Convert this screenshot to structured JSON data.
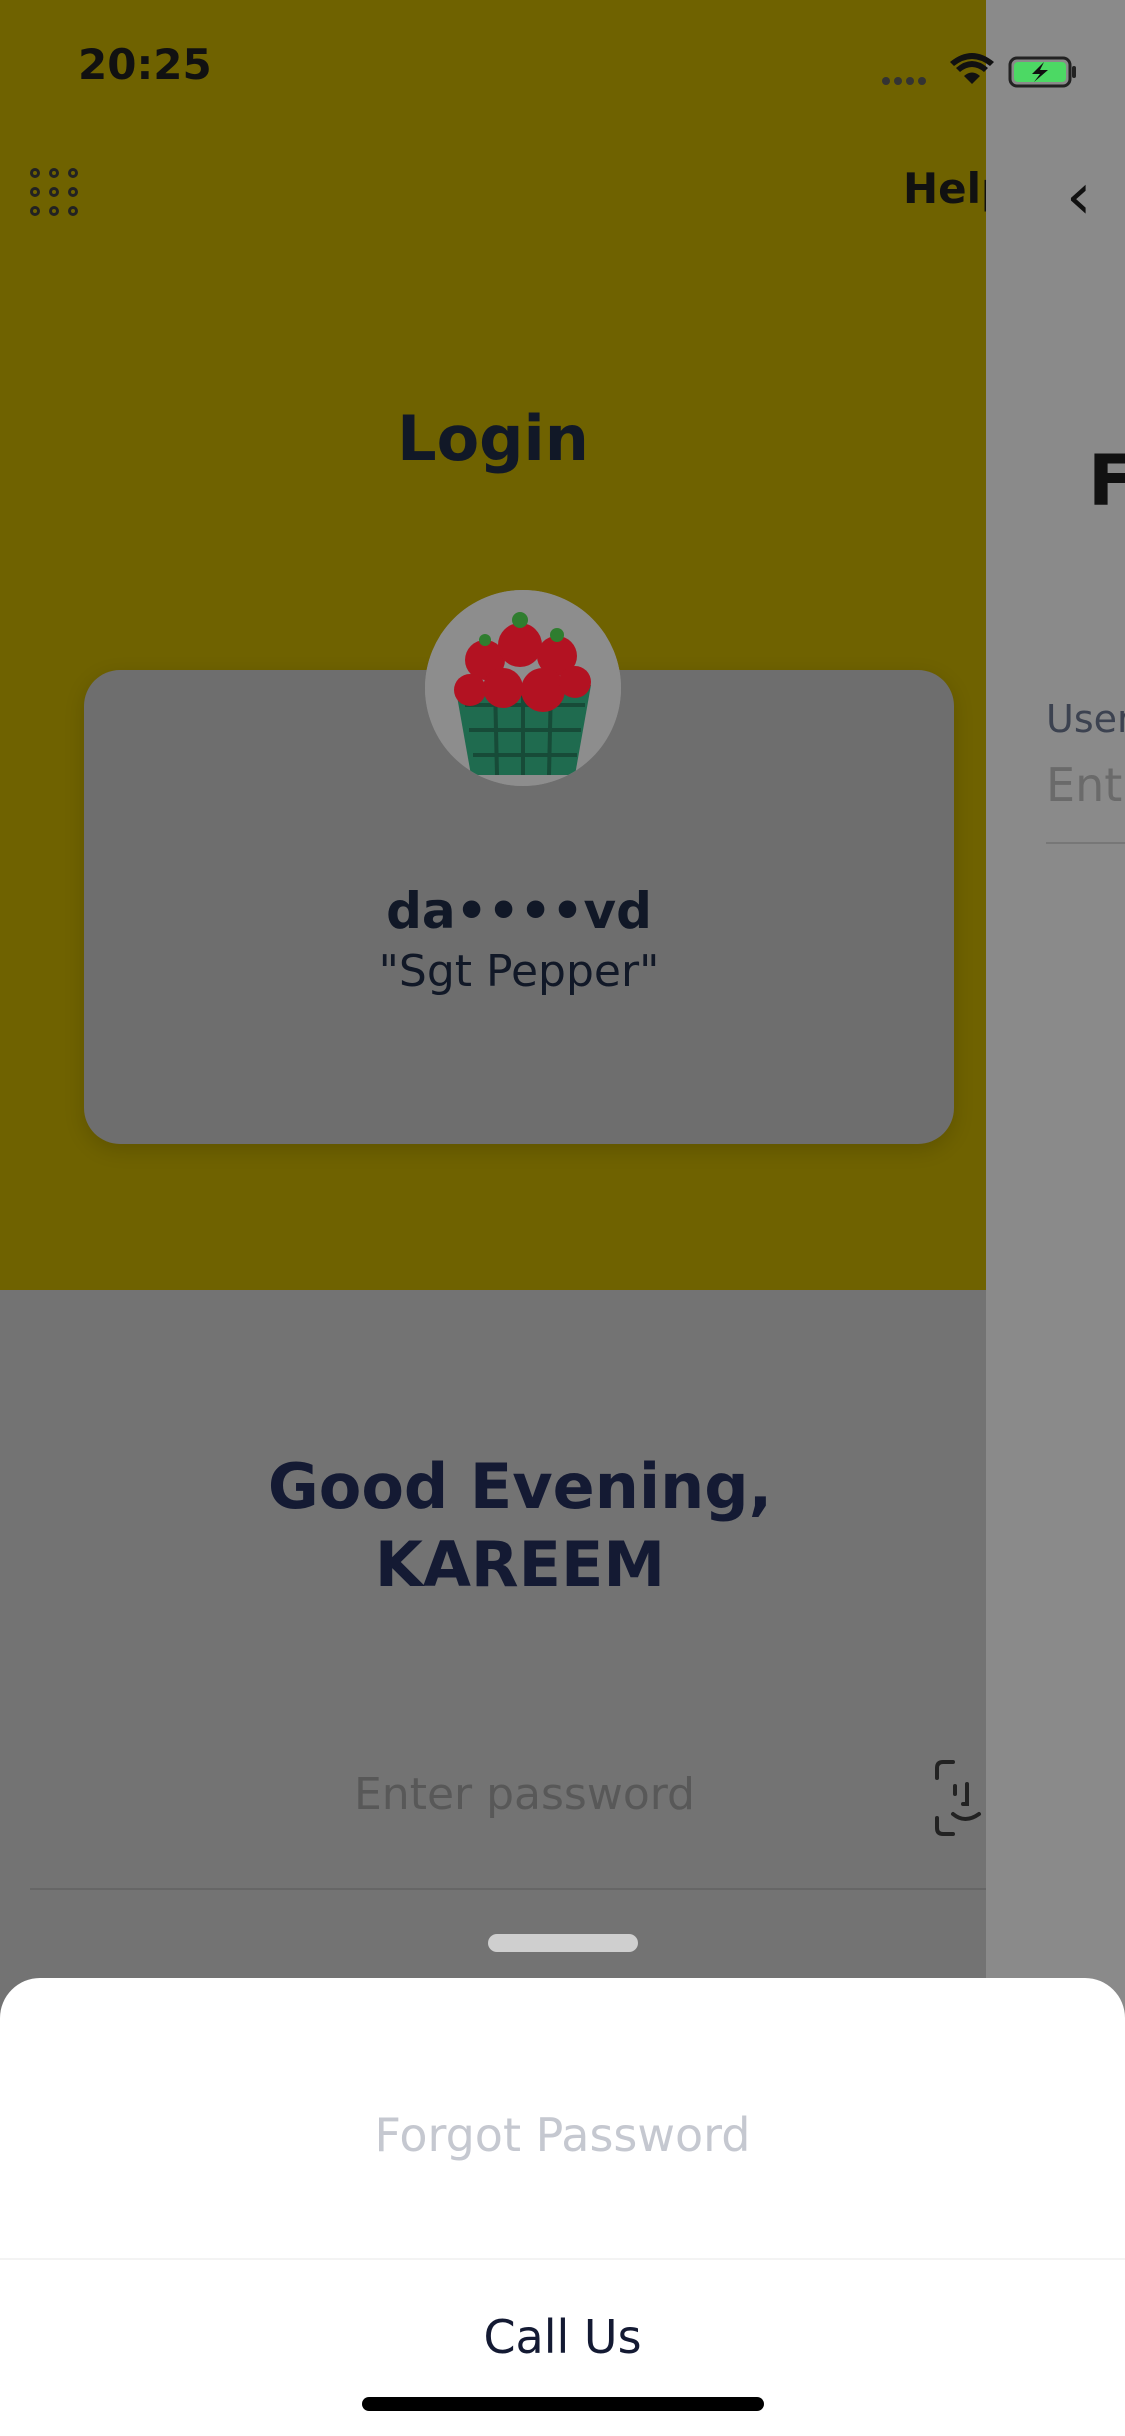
{
  "status_bar": {
    "time": "20:25"
  },
  "header": {
    "help_label": "Help",
    "title": "Login"
  },
  "account_card": {
    "name": "da••••vd",
    "nickname": "\"Sgt Pepper\""
  },
  "greeting": {
    "line1": "Good Evening,",
    "line2": "KAREEM"
  },
  "password": {
    "placeholder": "Enter password"
  },
  "next_screen": {
    "title_fragment": "F",
    "field_label_fragment": "User",
    "field_placeholder_fragment": "Ent"
  },
  "sheet": {
    "forgot_label": "Forgot Password",
    "call_label": "Call Us"
  },
  "colors": {
    "yellow_dimmed": "#6f6200",
    "text_dark": "#141a33",
    "battery_green": "#4cd964"
  }
}
